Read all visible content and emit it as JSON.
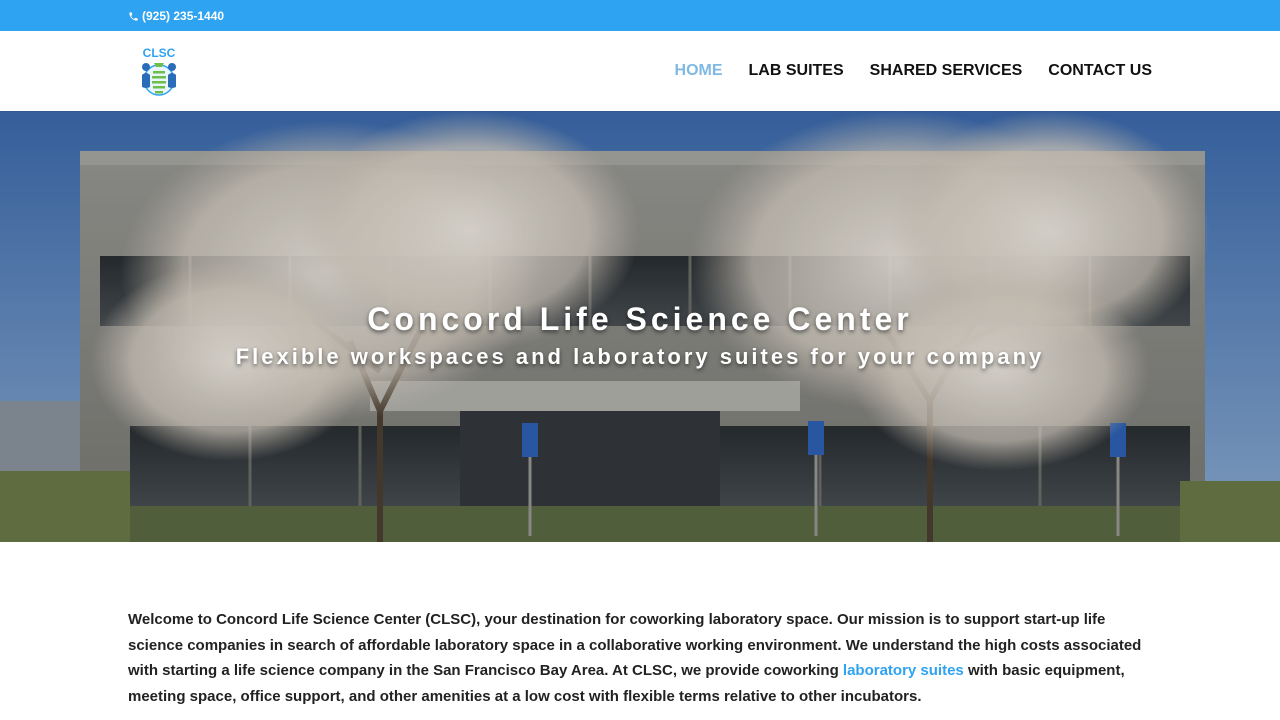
{
  "topbar": {
    "phone": "(925) 235-1440",
    "phone_icon": "phone-icon",
    "background": "#2ea3f2"
  },
  "header": {
    "logo_text": "CLSC",
    "nav": [
      {
        "label": "HOME",
        "active": true
      },
      {
        "label": "LAB SUITES",
        "active": false
      },
      {
        "label": "SHARED SERVICES",
        "active": false
      },
      {
        "label": "CONTACT US",
        "active": false
      }
    ],
    "active_color": "#7fb9e3"
  },
  "hero": {
    "title": "Concord Life Science Center",
    "subtitle": "Flexible workspaces and laboratory suites for your company"
  },
  "intro": {
    "text_before": "Welcome to Concord Life Science Center (CLSC), your destination for coworking laboratory space. Our mission is to support start-up life science companies in search of affordable laboratory space in a collaborative working environment. We understand the high costs associated with starting a life science company in the San Francisco Bay Area. At CLSC, we provide coworking ",
    "link_text": "laboratory suites",
    "text_after": " with basic equipment, meeting space, office support, and other amenities at a low cost with flexible terms relative to other incubators."
  }
}
